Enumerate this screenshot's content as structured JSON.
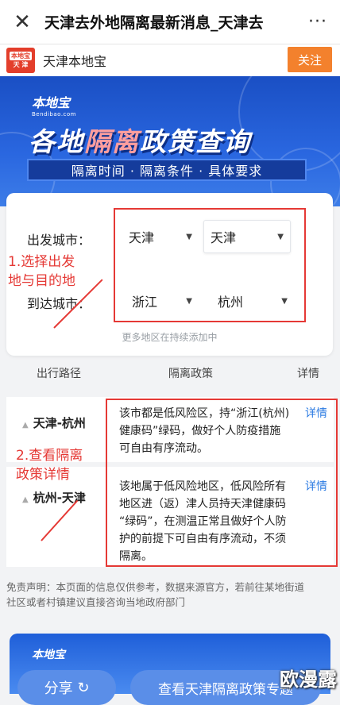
{
  "topbar": {
    "title": "天津去外地隔离最新消息_天津去",
    "close_icon": "close-icon",
    "more_icon": "more-dots-icon"
  },
  "account": {
    "logo_line1": "本地宝",
    "logo_line2": "天 津",
    "name": "天津本地宝",
    "follow_label": "关注"
  },
  "banner": {
    "brand": "本地宝",
    "brand_sub": "Bendibao.com",
    "headline_a": "各地",
    "headline_b": "隔离",
    "headline_c": "政策查询",
    "tagline": "隔离时间 · 隔离条件 · 具体要求"
  },
  "query": {
    "depart_label": "出发城市：",
    "arrive_label": "到达城市：",
    "depart_province": "天津",
    "depart_city": "天津",
    "arrive_province": "浙江",
    "arrive_city": "杭州",
    "note": "更多地区在持续添加中"
  },
  "annotations": {
    "step1_line1": "1.选择出发",
    "step1_line2": "地与目的地",
    "step2_line1": "2.查看隔离",
    "step2_line2": "政策详情"
  },
  "table": {
    "headers": [
      "出行路径",
      "隔离政策",
      "详情"
    ],
    "rows": [
      {
        "route": "天津-杭州",
        "policy": [
          "该市都是低风险区，持“浙江(杭州)",
          "健康码”绿码，做好个人防疫措施",
          "可自由有序流动。"
        ],
        "detail": "详情"
      },
      {
        "route": "杭州-天津",
        "policy": [
          "该地属于低风险地区，低风险所有",
          "地区进（返）津人员持天津健康码",
          "“绿码”，在测温正常且做好个人防",
          "护的前提下可自由有序流动，不须",
          "隔离。"
        ],
        "detail": "详情"
      }
    ]
  },
  "disclaimer": [
    "免责声明：本页面的信息仅供参考，数据来源官方，若前往某地街道",
    "社区或者村镇建议直接咨询当地政府部门"
  ],
  "bottom": {
    "brand": "本地宝",
    "share_label": "分享",
    "view_label": "查看天津隔离政策专题",
    "watermark": "欧漫露"
  },
  "colors": {
    "accent_red": "#e53935",
    "follow_orange": "#f3812d",
    "banner_blue": "#1a4fc4",
    "link_blue": "#2a7ae2"
  }
}
